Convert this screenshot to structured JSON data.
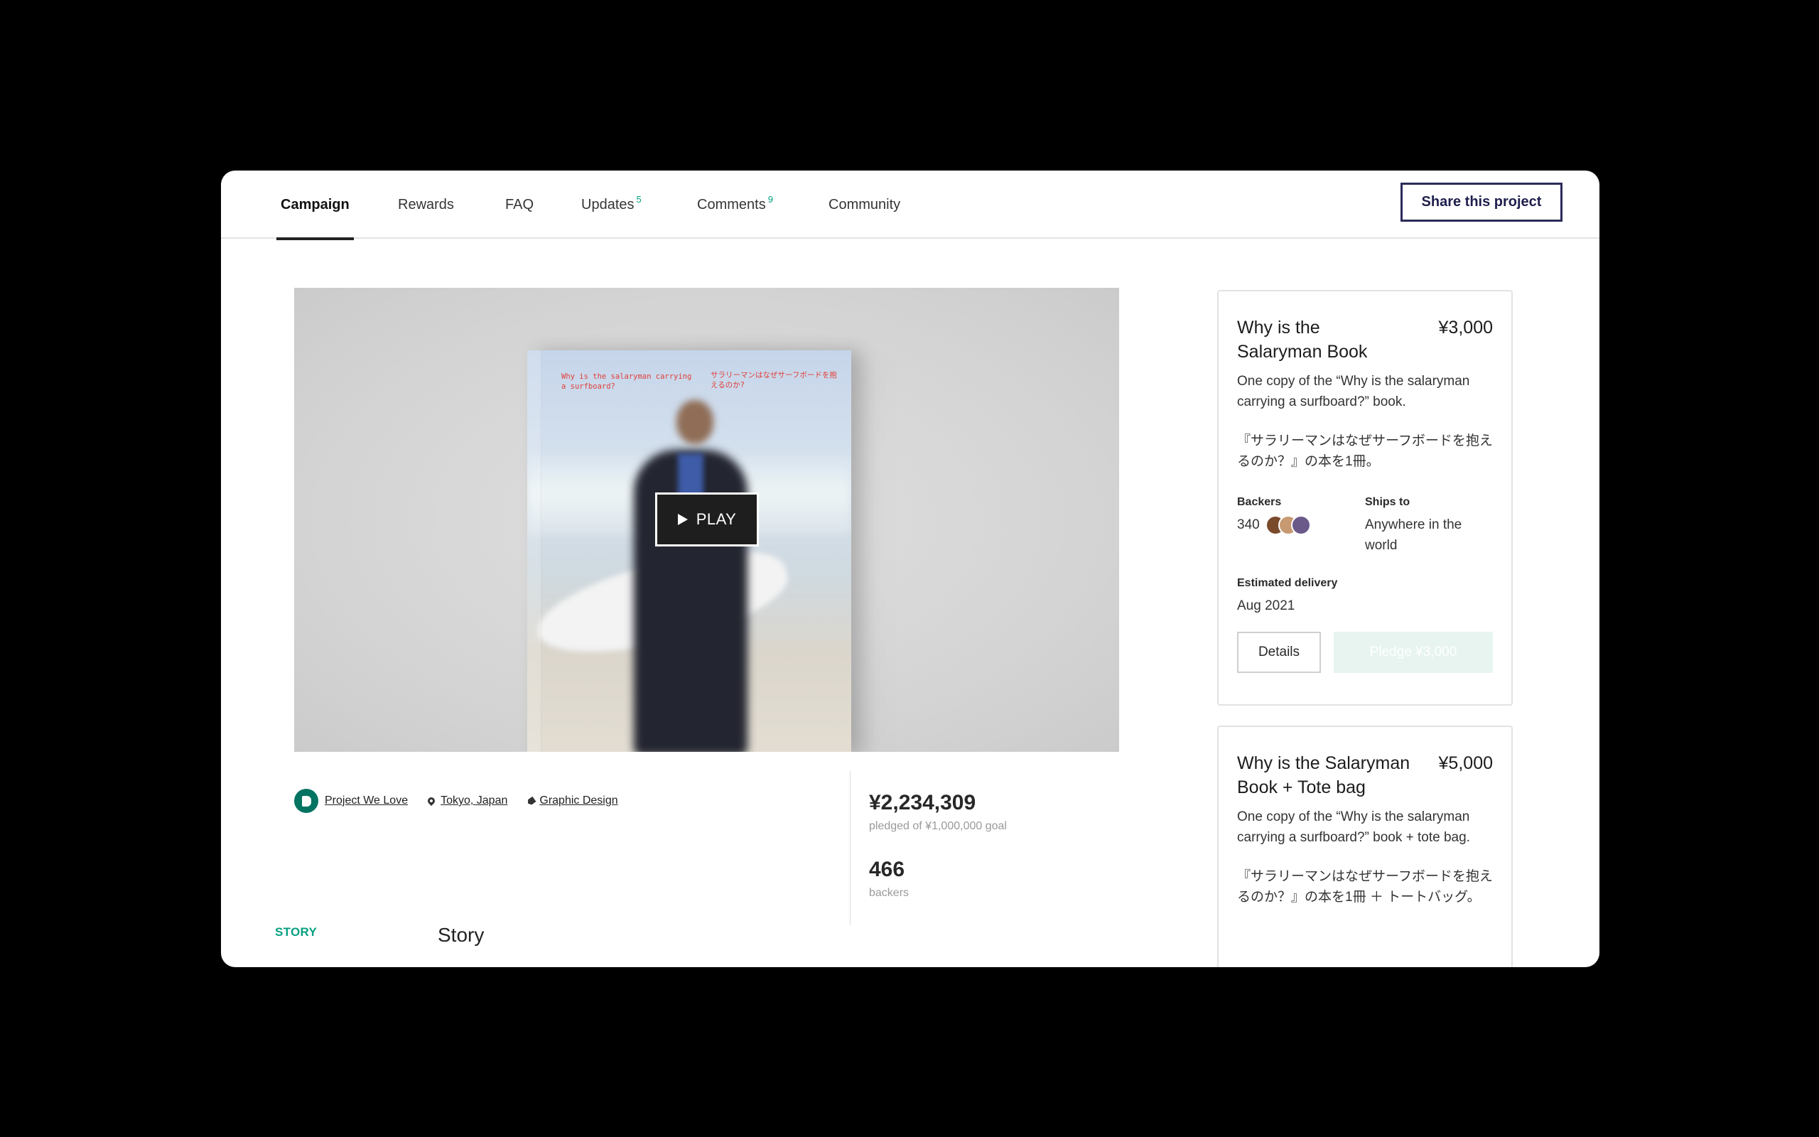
{
  "nav": {
    "tabs": [
      {
        "label": "Campaign",
        "count": ""
      },
      {
        "label": "Rewards",
        "count": ""
      },
      {
        "label": "FAQ",
        "count": ""
      },
      {
        "label": "Updates",
        "count": "5"
      },
      {
        "label": "Comments",
        "count": "9"
      },
      {
        "label": "Community",
        "count": ""
      }
    ],
    "active_tab": "Campaign",
    "share_label": "Share this project"
  },
  "video": {
    "play_label": "PLAY",
    "book_title_en": "Why is the salaryman carrying a surfboard?",
    "book_title_jp": "サラリーマンはなぜサーフボードを抱えるのか?"
  },
  "meta": {
    "badge": "Project We Love",
    "location": "Tokyo, Japan",
    "category": "Graphic Design"
  },
  "stats": {
    "pledged": "¥2,234,309",
    "pledged_caption": "pledged of ¥1,000,000 goal",
    "backers": "466",
    "backers_caption": "backers"
  },
  "story": {
    "tag": "STORY",
    "title": "Story"
  },
  "rewards": [
    {
      "title": "Why is the Salaryman Book",
      "price": "¥3,000",
      "description": "One copy of the “Why is the salaryman carrying a surfboard?” book.",
      "description_jp": "『サラリーマンはなぜサーフボードを抱えるのか？』の本を1冊。",
      "backers_label": "Backers",
      "backers_count": "340",
      "ships_label": "Ships to",
      "ships_value": "Anywhere in the world",
      "delivery_label": "Estimated delivery",
      "delivery_value": "Aug 2021",
      "details_label": "Details",
      "pledge_label": "Pledge ¥3,000"
    },
    {
      "title": "Why is the Salaryman Book + Tote bag",
      "price": "¥5,000",
      "description": "One copy of the “Why is the salaryman carrying a surfboard?” book + tote bag.",
      "description_jp": "『サラリーマンはなぜサーフボードを抱えるのか？』の本を1冊 ＋ トートバッグ。"
    }
  ],
  "colors": {
    "accent_green": "#05a081",
    "share_border": "#2b2b5a",
    "pwl_badge": "#037362"
  }
}
